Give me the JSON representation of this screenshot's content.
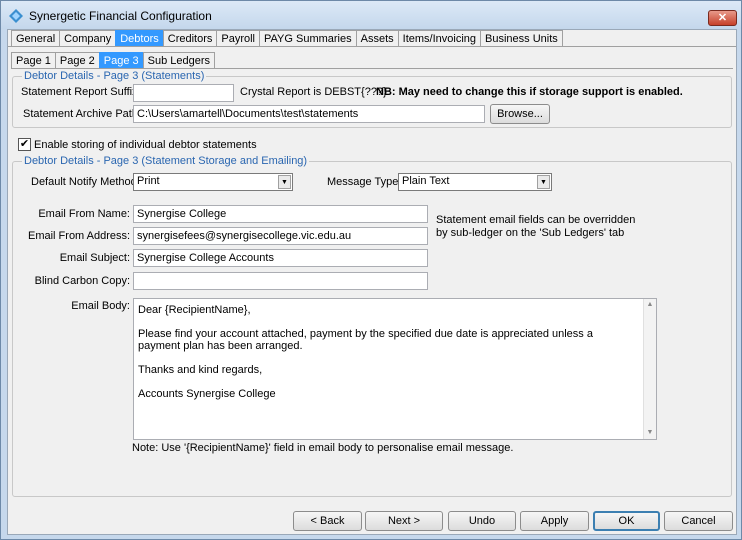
{
  "window": {
    "title": "Synergetic Financial Configuration",
    "close_label": "✕"
  },
  "main_tabs": [
    "General",
    "Company",
    "Debtors",
    "Creditors",
    "Payroll",
    "PAYG Summaries",
    "Assets",
    "Items/Invoicing",
    "Business Units"
  ],
  "active_main_tab": "Debtors",
  "sub_tabs": [
    "Page 1",
    "Page 2",
    "Page 3",
    "Sub Ledgers"
  ],
  "active_sub_tab": "Page 3",
  "statements_group": {
    "title": "Debtor Details  - Page 3 (Statements)",
    "suffix_label": "Statement Report Suffix:",
    "suffix_value": "",
    "crystal_note": "Crystal Report is DEBST{???}",
    "nb_note": "NB: May need to change this if storage support is enabled.",
    "archive_label": "Statement Archive Path:",
    "archive_value": "C:\\Users\\amartell\\Documents\\test\\statements",
    "browse_label": "Browse..."
  },
  "enable_storing": {
    "checked": true,
    "check_mark": "✔",
    "label": "Enable storing of individual debtor statements"
  },
  "storage_group": {
    "title": "Debtor Details  - Page 3 (Statement Storage and Emailing)",
    "notify_label": "Default Notify Method:",
    "notify_value": "Print",
    "message_type_label": "Message Type:",
    "message_type_value": "Plain Text",
    "from_name_label": "Email From Name:",
    "from_name_value": "Synergise College",
    "from_address_label": "Email From Address:",
    "from_address_value": "synergisefees@synergisecollege.vic.edu.au",
    "subject_label": "Email Subject:",
    "subject_value": "Synergise College Accounts",
    "bcc_label": "Blind Carbon Copy:",
    "bcc_value": "",
    "override_note": "Statement email fields can be overridden by sub-ledger on the 'Sub Ledgers' tab",
    "body_label": "Email Body:",
    "body_lines": [
      "Dear {RecipientName},",
      "",
      "Please find your account attached, payment by the specified due date is appreciated unless a payment plan has been arranged.",
      "",
      "Thanks and kind regards,",
      "",
      "Accounts Synergise College"
    ],
    "note": "Note:  Use '{RecipientName}' field in email body to personalise email message."
  },
  "buttons": {
    "back": "< Back",
    "next": "Next >",
    "undo": "Undo",
    "apply": "Apply",
    "ok": "OK",
    "cancel": "Cancel"
  }
}
